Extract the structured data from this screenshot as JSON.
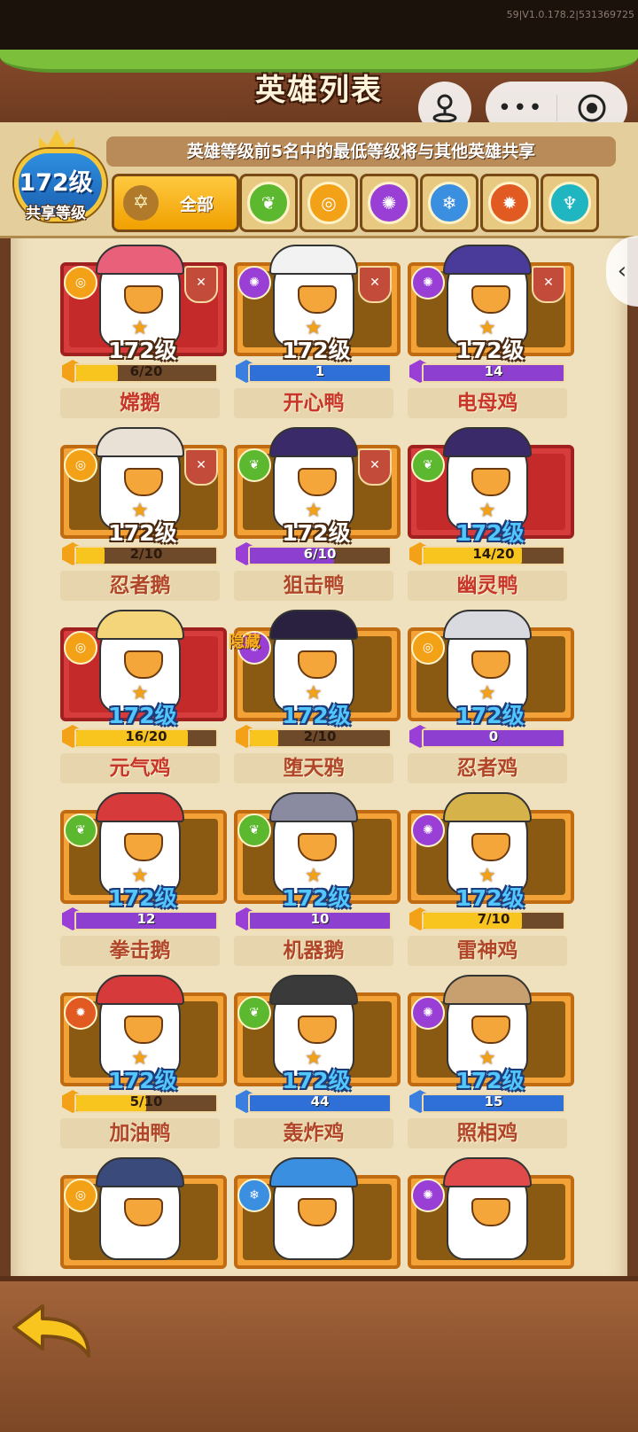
{
  "version_text": "59|V1.0.178.2|531369725",
  "title": "英雄列表",
  "notice": "英雄等级前5名中的最低等级将与其他英雄共享",
  "shared_level": {
    "value": "172级",
    "label": "共享等级"
  },
  "filters": {
    "all_label": "全部",
    "elements": [
      {
        "icon": "nature-icon",
        "color": "#5cb82e"
      },
      {
        "icon": "wind-icon",
        "color": "#f3a116"
      },
      {
        "icon": "arcane-icon",
        "color": "#9a3fd6"
      },
      {
        "icon": "ice-icon",
        "color": "#3a8fe0"
      },
      {
        "icon": "fire-icon",
        "color": "#e05a22"
      },
      {
        "icon": "water-icon",
        "color": "#1fb6c2"
      }
    ]
  },
  "heroes": [
    {
      "name": "嫦鹅",
      "level": "172级",
      "progress": "6/20",
      "fill": 0.3,
      "frame": "red",
      "element": "wind-icon",
      "shield": true,
      "level_style": "white",
      "gem": "orange"
    },
    {
      "name": "开心鸭",
      "level": "172级",
      "progress": "1",
      "fill": 1.0,
      "frame": "orange",
      "element": "arcane-icon",
      "shield": true,
      "level_style": "white",
      "gem": "blue"
    },
    {
      "name": "电母鸡",
      "level": "172级",
      "progress": "14",
      "fill": 1.0,
      "frame": "orange",
      "element": "arcane-icon",
      "shield": true,
      "level_style": "white",
      "gem": "purple"
    },
    {
      "name": "忍者鹅",
      "level": "172级",
      "progress": "2/10",
      "fill": 0.2,
      "frame": "orange",
      "element": "wind-icon",
      "shield": true,
      "level_style": "white",
      "gem": "orange"
    },
    {
      "name": "狙击鸭",
      "level": "172级",
      "progress": "6/10",
      "fill": 0.6,
      "frame": "orange",
      "element": "nature-icon",
      "shield": true,
      "level_style": "white",
      "gem": "purple"
    },
    {
      "name": "幽灵鸭",
      "level": "172级",
      "progress": "14/20",
      "fill": 0.7,
      "frame": "red",
      "element": "nature-icon",
      "shield": false,
      "level_style": "blue",
      "gem": "orange"
    },
    {
      "name": "元气鸡",
      "level": "172级",
      "progress": "16/20",
      "fill": 0.8,
      "frame": "red",
      "element": "wind-icon",
      "shield": false,
      "level_style": "blue",
      "gem": "orange"
    },
    {
      "name": "堕天鸦",
      "level": "172级",
      "progress": "2/10",
      "fill": 0.2,
      "frame": "orange",
      "element": "arcane-icon",
      "shield": false,
      "level_style": "blue",
      "gem": "orange",
      "tag": "隐藏"
    },
    {
      "name": "忍者鸡",
      "level": "172级",
      "progress": "0",
      "fill": 1.0,
      "frame": "orange",
      "element": "wind-icon",
      "shield": false,
      "level_style": "blue",
      "gem": "purple"
    },
    {
      "name": "拳击鹅",
      "level": "172级",
      "progress": "12",
      "fill": 1.0,
      "frame": "orange",
      "element": "nature-icon",
      "shield": false,
      "level_style": "blue",
      "gem": "purple"
    },
    {
      "name": "机器鹅",
      "level": "172级",
      "progress": "10",
      "fill": 1.0,
      "frame": "orange",
      "element": "nature-icon",
      "shield": false,
      "level_style": "blue",
      "gem": "purple"
    },
    {
      "name": "雷神鸡",
      "level": "172级",
      "progress": "7/10",
      "fill": 0.7,
      "frame": "orange",
      "element": "arcane-icon",
      "shield": false,
      "level_style": "blue",
      "gem": "orange"
    },
    {
      "name": "加油鸭",
      "level": "172级",
      "progress": "5/10",
      "fill": 0.5,
      "frame": "orange",
      "element": "fire-icon",
      "shield": false,
      "level_style": "blue",
      "gem": "orange"
    },
    {
      "name": "轰炸鸡",
      "level": "172级",
      "progress": "44",
      "fill": 1.0,
      "frame": "orange",
      "element": "nature-icon",
      "shield": false,
      "level_style": "blue",
      "gem": "blue"
    },
    {
      "name": "照相鸡",
      "level": "172级",
      "progress": "15",
      "fill": 1.0,
      "frame": "orange",
      "element": "arcane-icon",
      "shield": false,
      "level_style": "blue",
      "gem": "blue"
    },
    {
      "name": "",
      "level": "",
      "progress": "",
      "fill": 0,
      "frame": "orange",
      "element": "wind-icon",
      "shield": false,
      "level_style": "blue",
      "gem": ""
    },
    {
      "name": "",
      "level": "",
      "progress": "",
      "fill": 0,
      "frame": "orange",
      "element": "ice-icon",
      "shield": false,
      "level_style": "blue",
      "gem": ""
    },
    {
      "name": "",
      "level": "",
      "progress": "",
      "fill": 0,
      "frame": "orange",
      "element": "arcane-icon",
      "shield": false,
      "level_style": "blue",
      "gem": ""
    }
  ],
  "colors": {
    "gem_orange": "#f3a116",
    "gem_blue": "#3a7fe0",
    "gem_purple": "#9a3fd6",
    "bar_yellow": "#f7c51e",
    "bar_blue": "#2f6fd8",
    "bar_purple": "#8d3fd0"
  }
}
